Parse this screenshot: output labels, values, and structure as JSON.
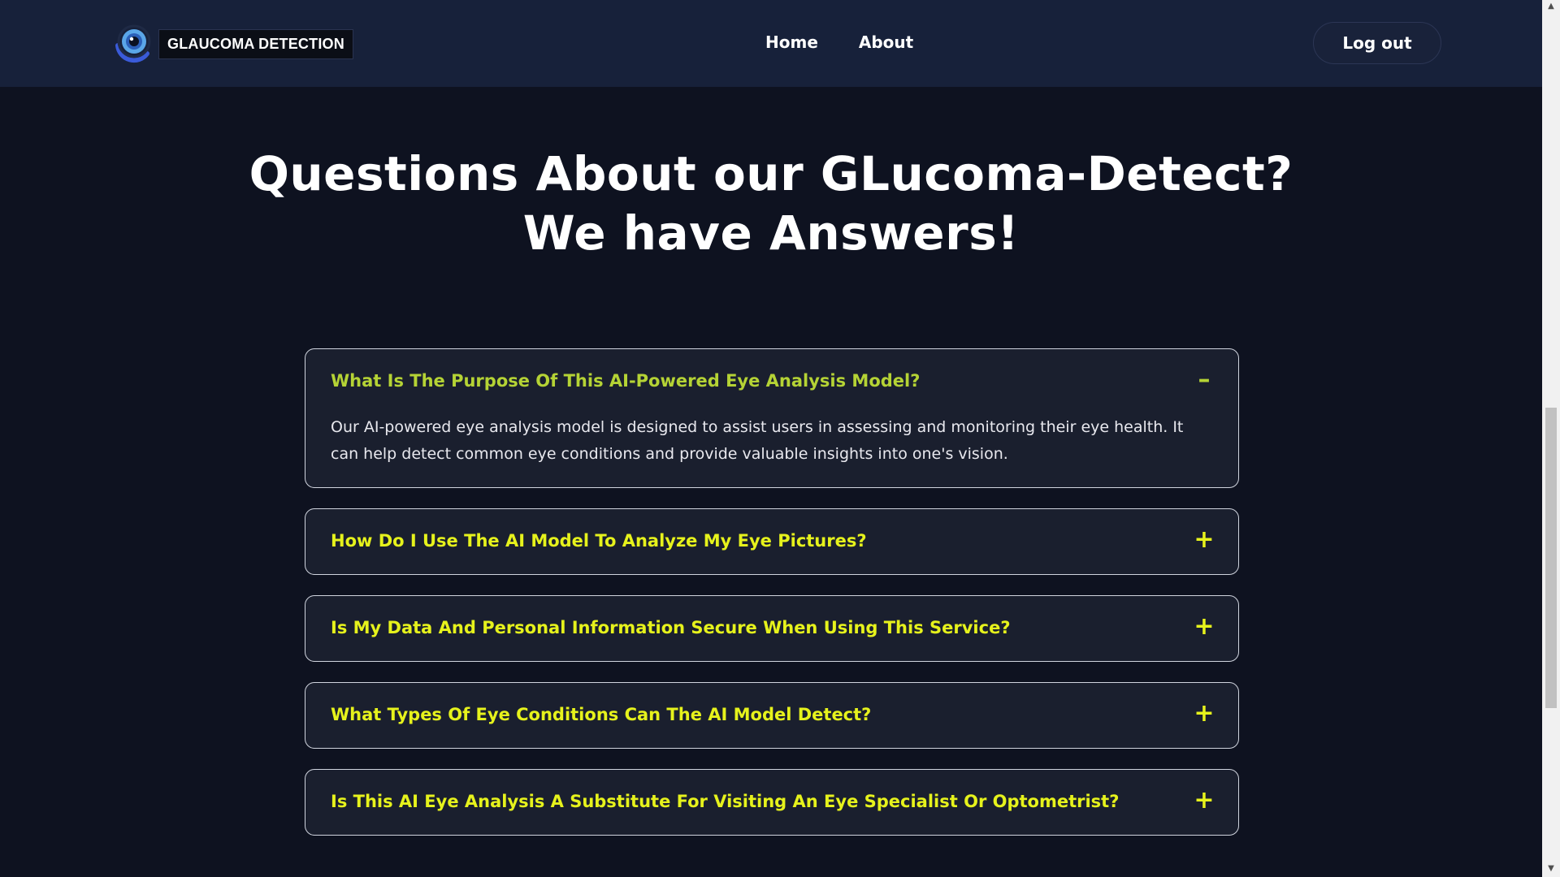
{
  "nav": {
    "brand": "GLAUCOMA DETECTION",
    "links": [
      "Home",
      "About"
    ],
    "logout": "Log out"
  },
  "headline": {
    "line1": "Questions About our GLucoma-Detect?",
    "line2": "We have Answers!"
  },
  "faq": [
    {
      "question": "What Is The Purpose Of This AI-Powered Eye Analysis Model?",
      "answer": "Our AI-powered eye analysis model is designed to assist users in assessing and monitoring their eye health. It can help detect common eye conditions and provide valuable insights into one's vision.",
      "open": true,
      "toggle": "–"
    },
    {
      "question": "How Do I Use The AI Model To Analyze My Eye Pictures?",
      "open": false,
      "toggle": "+"
    },
    {
      "question": "Is My Data And Personal Information Secure When Using This Service?",
      "open": false,
      "toggle": "+"
    },
    {
      "question": "What Types Of Eye Conditions Can The AI Model Detect?",
      "open": false,
      "toggle": "+"
    },
    {
      "question": "Is This AI Eye Analysis A Substitute For Visiting An Eye Specialist Or Optometrist?",
      "open": false,
      "toggle": "+"
    }
  ],
  "colors": {
    "background": "#0e1220",
    "navbar": "#17213a",
    "accent": "#e6f21c",
    "accent_open": "#b5d335",
    "card": "#1a1f2e"
  },
  "icons": {
    "logo": "eye-logo-icon",
    "expanded": "minus-icon",
    "collapsed": "plus-icon"
  }
}
